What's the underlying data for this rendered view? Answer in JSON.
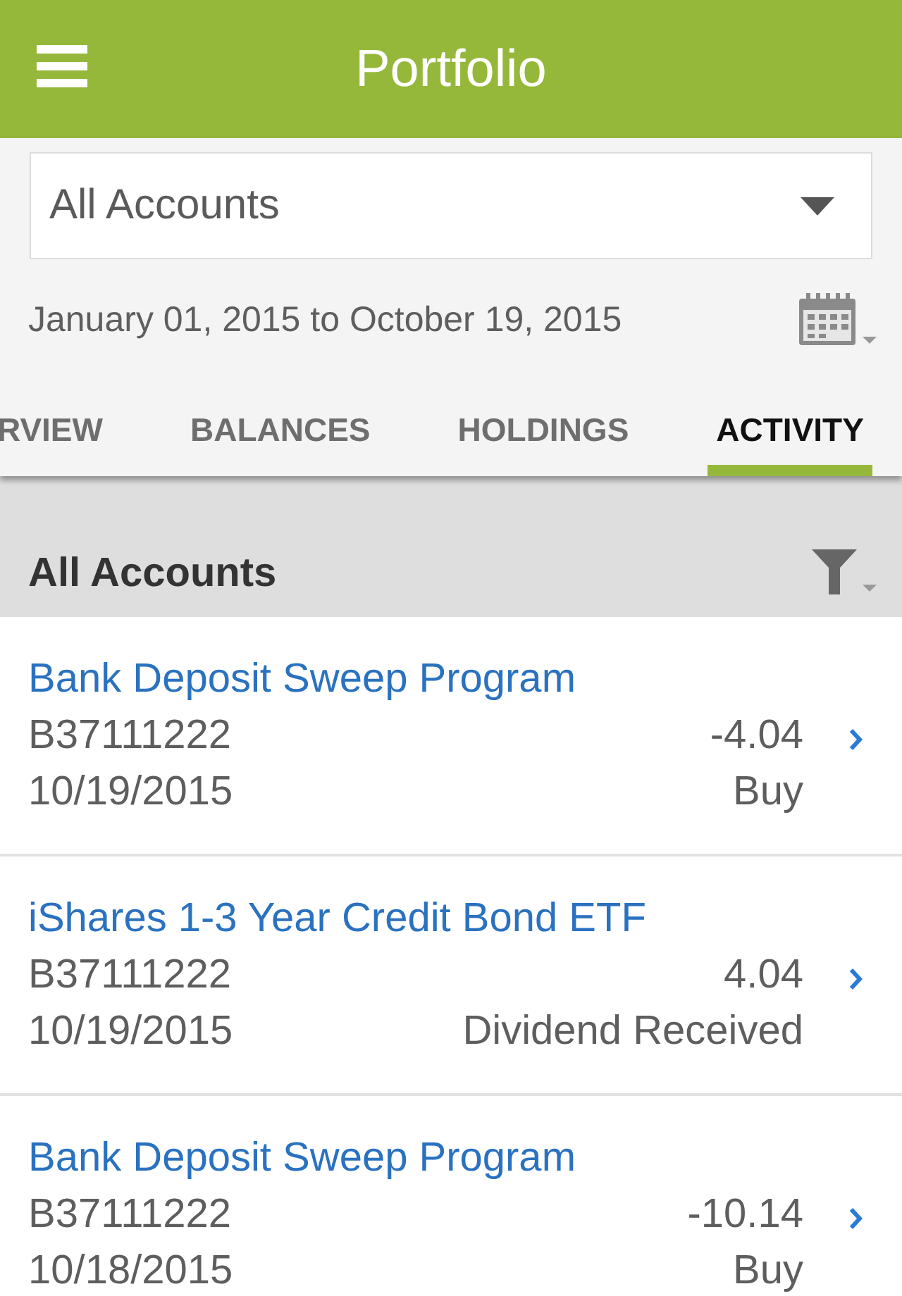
{
  "app_bar": {
    "title": "Portfolio"
  },
  "account_selector": {
    "value": "All Accounts"
  },
  "date_range": "January 01, 2015 to October 19, 2015",
  "tabs": [
    {
      "label": "RVIEW",
      "selected": false
    },
    {
      "label": "BALANCES",
      "selected": false
    },
    {
      "label": "HOLDINGS",
      "selected": false
    },
    {
      "label": "ACTIVITY",
      "selected": true
    }
  ],
  "section": {
    "title": "All Accounts"
  },
  "activities": [
    {
      "name": "Bank Deposit Sweep Program",
      "account": "B37111222",
      "date": "10/19/2015",
      "amount": "-4.04",
      "type": "Buy"
    },
    {
      "name": "iShares 1-3 Year Credit Bond ETF",
      "account": "B37111222",
      "date": "10/19/2015",
      "amount": "4.04",
      "type": "Dividend Received"
    },
    {
      "name": "Bank Deposit Sweep Program",
      "account": "B37111222",
      "date": "10/18/2015",
      "amount": "-10.14",
      "type": "Buy"
    }
  ]
}
